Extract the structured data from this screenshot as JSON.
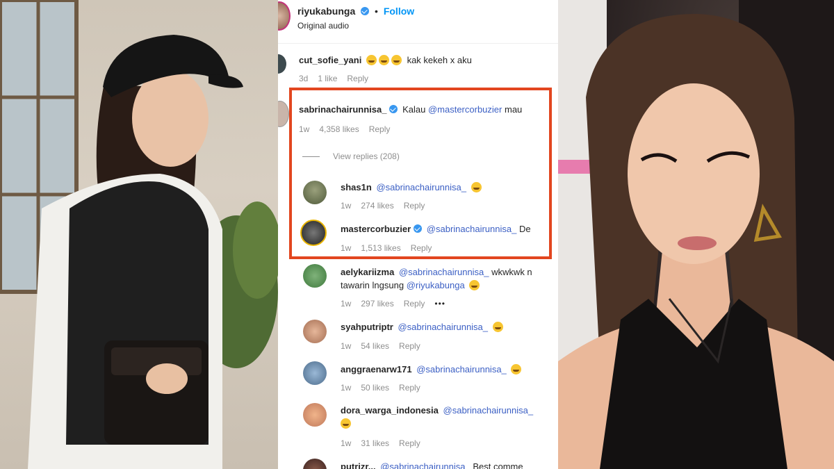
{
  "post_header": {
    "username": "riyukabunga",
    "separator": "•",
    "follow_label": "Follow",
    "audio_label": "Original audio"
  },
  "comments": [
    {
      "username": "cut_sofie_yani",
      "text": "kak kekeh x aku",
      "time": "3d",
      "likes": "1 like",
      "reply": "Reply"
    },
    {
      "username": "sabrinachairunnisa_",
      "text_prefix": "Kalau",
      "mention": "@mastercorbuzier",
      "text_suffix": "mau",
      "time": "1w",
      "likes": "4,358 likes",
      "reply": "Reply",
      "view_replies": "View replies (208)"
    },
    {
      "username": "shas1n",
      "mention": "@sabrinachairunnisa_",
      "time": "1w",
      "likes": "274 likes",
      "reply": "Reply"
    },
    {
      "username": "mastercorbuzier",
      "mention": "@sabrinachairunnisa_",
      "text_suffix": "De",
      "time": "1w",
      "likes": "1,513 likes",
      "reply": "Reply"
    },
    {
      "username": "aelykariizma",
      "mention": "@sabrinachairunnisa_",
      "text_suffix": "wkwkwk n",
      "line2_prefix": "tawarin lngsung",
      "mention2": "@riyukabunga",
      "time": "1w",
      "likes": "297 likes",
      "reply": "Reply",
      "more": "•••"
    },
    {
      "username": "syahputriptr",
      "mention": "@sabrinachairunnisa_",
      "time": "1w",
      "likes": "54 likes",
      "reply": "Reply"
    },
    {
      "username": "anggraenarw171",
      "mention": "@sabrinachairunnisa_",
      "time": "1w",
      "likes": "50 likes",
      "reply": "Reply"
    },
    {
      "username": "dora_warga_indonesia",
      "mention": "@sabrinachairunnisa_",
      "time": "1w",
      "likes": "31 likes",
      "reply": "Reply"
    },
    {
      "username": "putrizr...",
      "mention": "@sabrinachairunnisa_",
      "text_suffix": "Best comme"
    }
  ],
  "colors": {
    "highlight": "#e2461f",
    "mention": "#3b5fc4",
    "verified": "#3897f0",
    "meta": "#8e8e8e"
  }
}
